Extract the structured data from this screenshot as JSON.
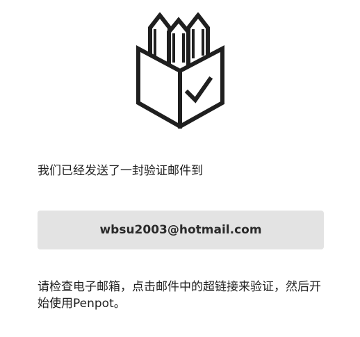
{
  "logo": {
    "icon": "penpot-logo-icon"
  },
  "verify": {
    "intro_text": "我们已经发送了一封验证邮件到",
    "email": "wbsu2003@hotmail.com",
    "instructions_text": "请检查电子邮箱，点击邮件中的超链接来验证，然后开始使用Penpot。"
  }
}
